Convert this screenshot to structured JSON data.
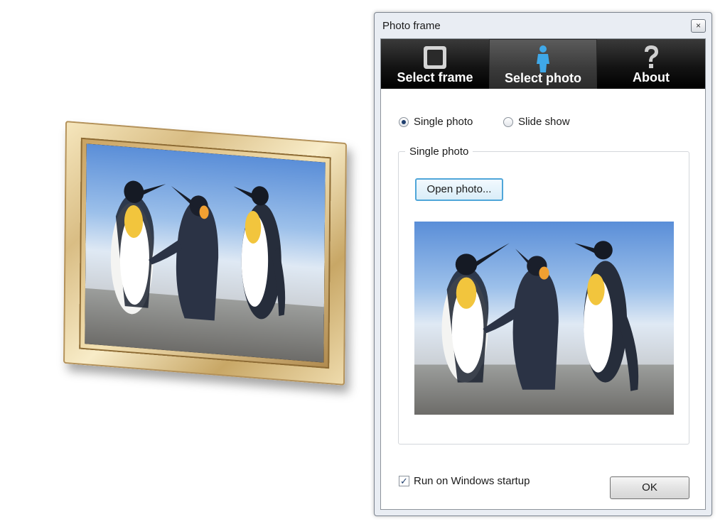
{
  "window": {
    "title": "Photo frame",
    "close_glyph": "×"
  },
  "tabs": [
    {
      "label": "Select frame",
      "icon": "frame-icon",
      "active": false
    },
    {
      "label": "Select photo",
      "icon": "person-icon",
      "active": true
    },
    {
      "label": "About",
      "icon": "question-icon",
      "active": false
    }
  ],
  "mode": {
    "options": [
      {
        "label": "Single photo",
        "checked": true
      },
      {
        "label": "Slide show",
        "checked": false
      }
    ]
  },
  "single_photo_group": {
    "label": "Single photo",
    "open_button": "Open photo..."
  },
  "startup": {
    "label": "Run on Windows startup",
    "checked": true,
    "check_glyph": "✓"
  },
  "ok_button": "OK",
  "colors": {
    "tab_bar": "#141414",
    "active_tab": "#4a4a4a",
    "open_button_border": "#4fa6d9",
    "frame_gold": "#d9bd84"
  }
}
